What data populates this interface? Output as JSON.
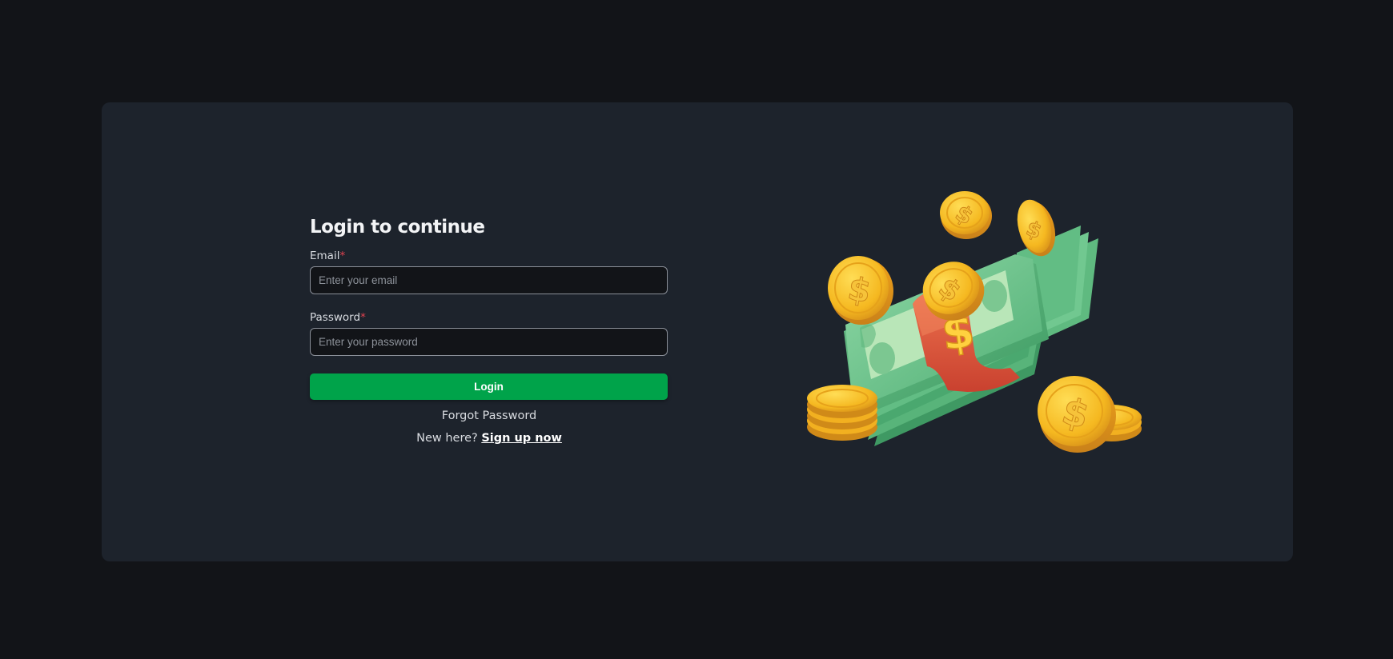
{
  "login": {
    "title": "Login to continue",
    "email_label": "Email",
    "email_required": "*",
    "email_placeholder": "Enter your email",
    "password_label": "Password",
    "password_required": "*",
    "password_placeholder": "Enter your password",
    "login_button": "Login",
    "forgot_password": "Forgot Password",
    "new_here": "New here?",
    "signup_link": "Sign up now"
  },
  "illustration": {
    "icon": "money-stack-with-coins-icon",
    "coin_symbol": "$"
  },
  "colors": {
    "page_bg": "#121418",
    "card_bg": "#1d232c",
    "primary": "#00a34a",
    "required": "#e0424f",
    "cash_green": "#6cc690",
    "coin_gold": "#f5b820",
    "band_red": "#e2583f"
  }
}
